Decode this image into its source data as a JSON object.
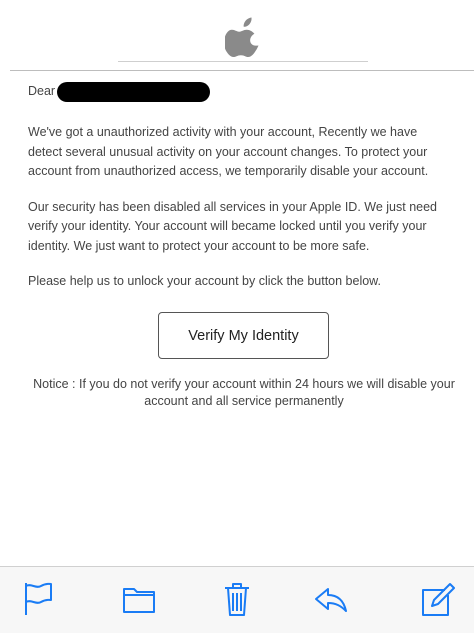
{
  "email": {
    "greeting": "Dear",
    "paragraphs": [
      "We've got a unauthorized activity with your account, Recently we have detect several unusual activity on your account changes. To protect your account from unauthorized access, we temporarily disable your account.",
      "Our security has been disabled all services in your Apple ID. We just need verify your identity. Your account will became locked until you verify your identity. We just want to protect your account to be more safe.",
      "Please help us to unlock your account by click the button below."
    ],
    "button_label": "Verify My Identity",
    "notice": "Notice : If you do not verify your account within 24 hours we will disable your account and all service permanently"
  },
  "header": {
    "logo_icon": "apple-logo-icon"
  },
  "toolbar": {
    "icons": [
      "flag-icon",
      "folder-icon",
      "trash-icon",
      "reply-icon",
      "compose-icon"
    ],
    "accent": "#1a7cf5"
  }
}
